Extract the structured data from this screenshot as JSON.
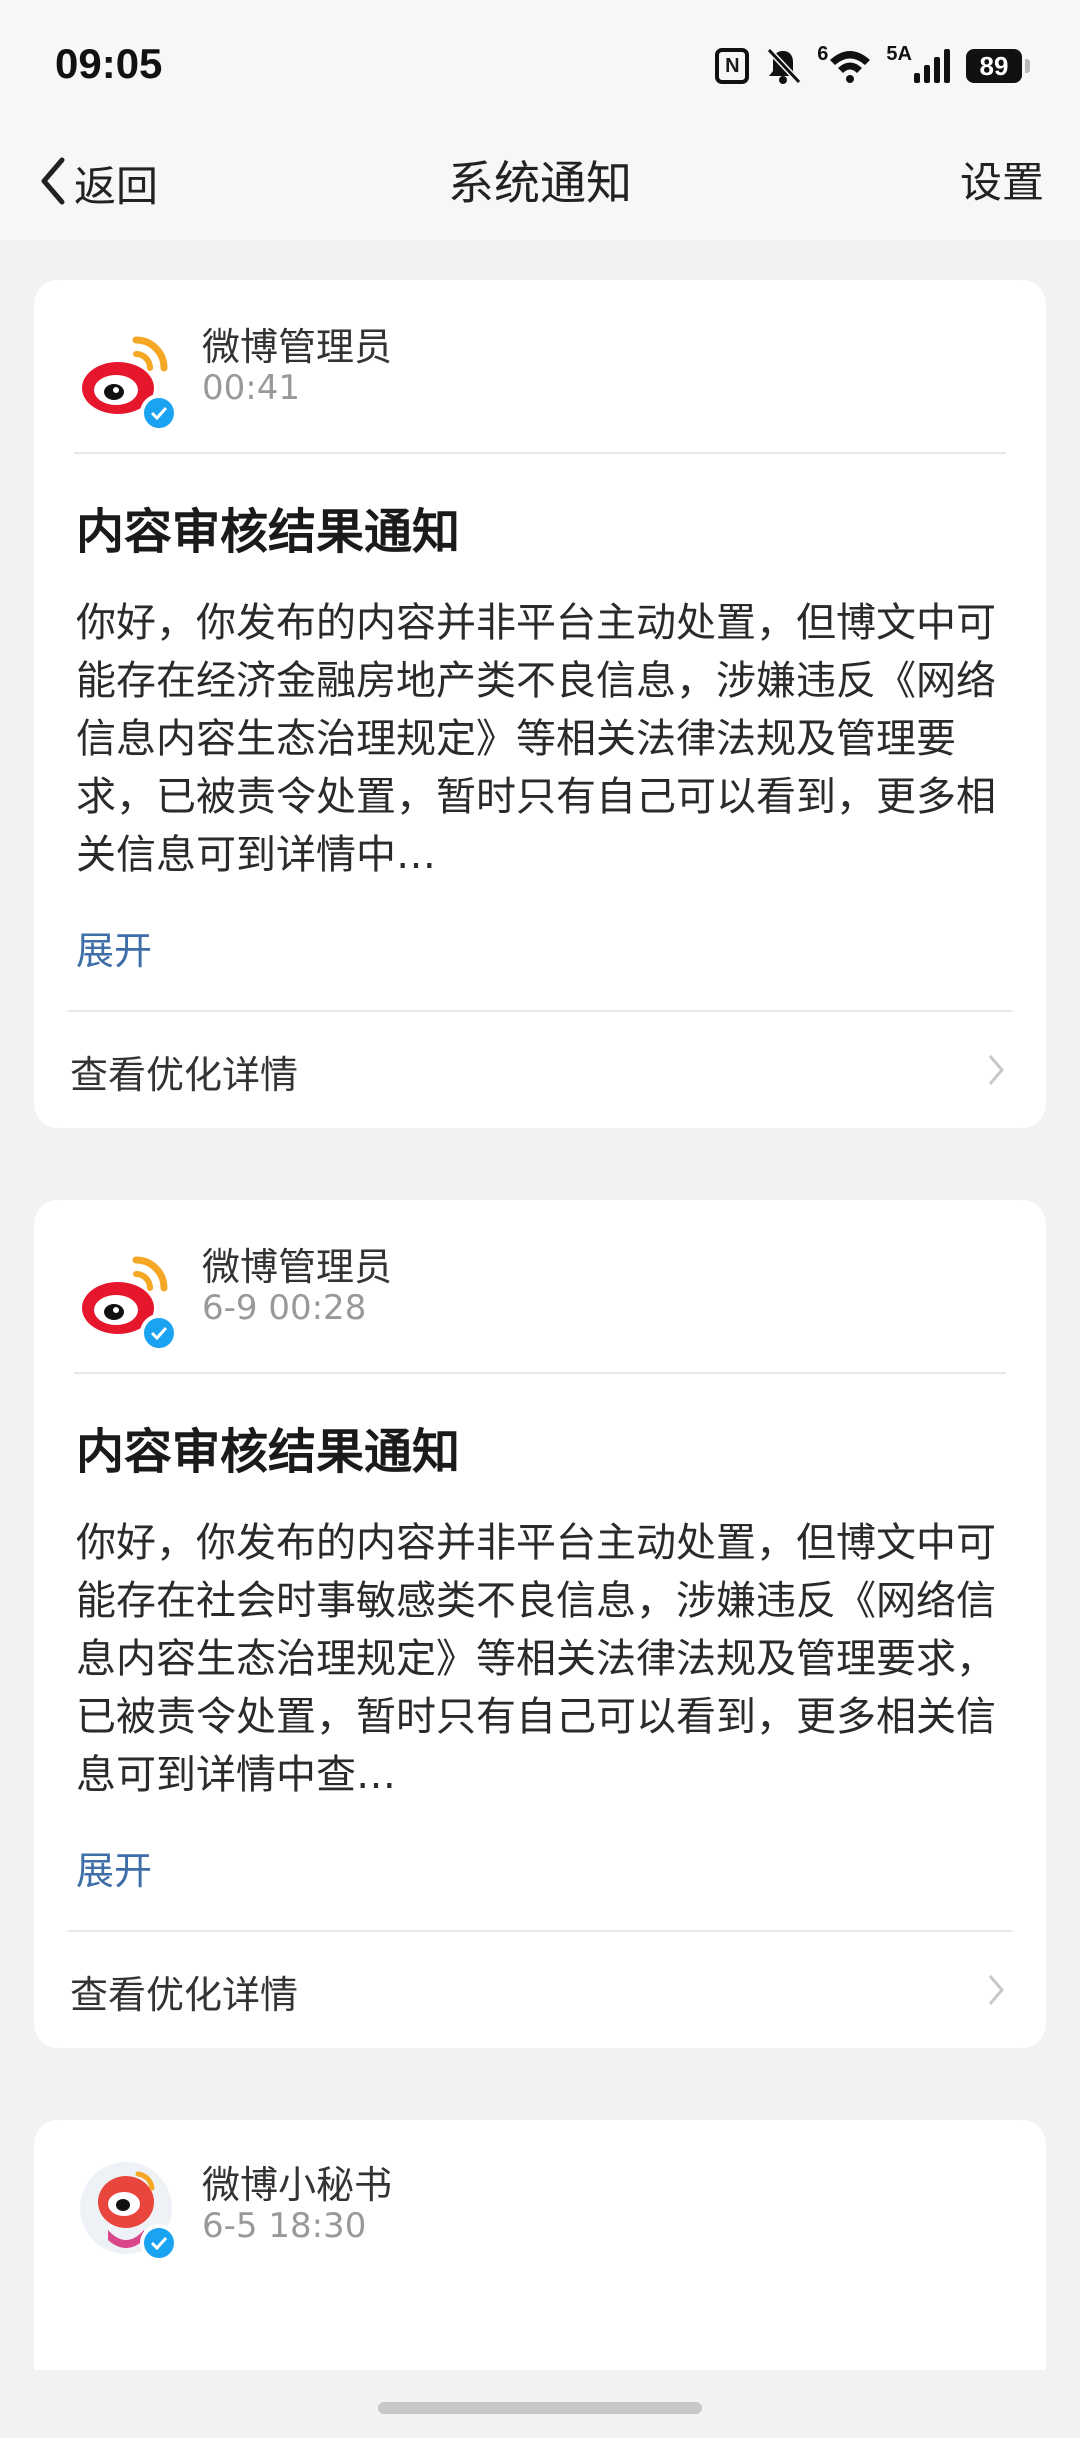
{
  "status_bar": {
    "time": "09:05",
    "network_label": "5A",
    "wifi_label": "6",
    "battery": "89",
    "nfc_label": "N",
    "icons": [
      "nfc-icon",
      "bell-muted-icon",
      "wifi-icon",
      "signal-icon",
      "battery-icon"
    ]
  },
  "nav": {
    "back_label": "返回",
    "title": "系统通知",
    "settings_label": "设置"
  },
  "notifications": [
    {
      "sender": "微博管理员",
      "time": "00:41",
      "title": "内容审核结果通知",
      "body": "你好，你发布的内容并非平台主动处置，但博文中可能存在经济金融房地产类不良信息，涉嫌违反《网络信息内容生态治理规定》等相关法律法规及管理要求，已被责令处置，暂时只有自己可以看到，更多相关信息可到详情中…",
      "expand_label": "展开",
      "detail_label": "查看优化详情"
    },
    {
      "sender": "微博管理员",
      "time": "6-9 00:28",
      "title": "内容审核结果通知",
      "body": "你好，你发布的内容并非平台主动处置，但博文中可能存在社会时事敏感类不良信息，涉嫌违反《网络信息内容生态治理规定》等相关法律法规及管理要求，已被责令处置，暂时只有自己可以看到，更多相关信息可到详情中查…",
      "expand_label": "展开",
      "detail_label": "查看优化详情"
    },
    {
      "sender": "微博小秘书",
      "time": "6-5 18:30"
    }
  ],
  "colors": {
    "background": "#f2f2f2",
    "card": "#ffffff",
    "link": "#3d6ea8",
    "verified": "#1aa3f0",
    "weibo_red": "#e6162d",
    "weibo_orange": "#f5a623"
  }
}
